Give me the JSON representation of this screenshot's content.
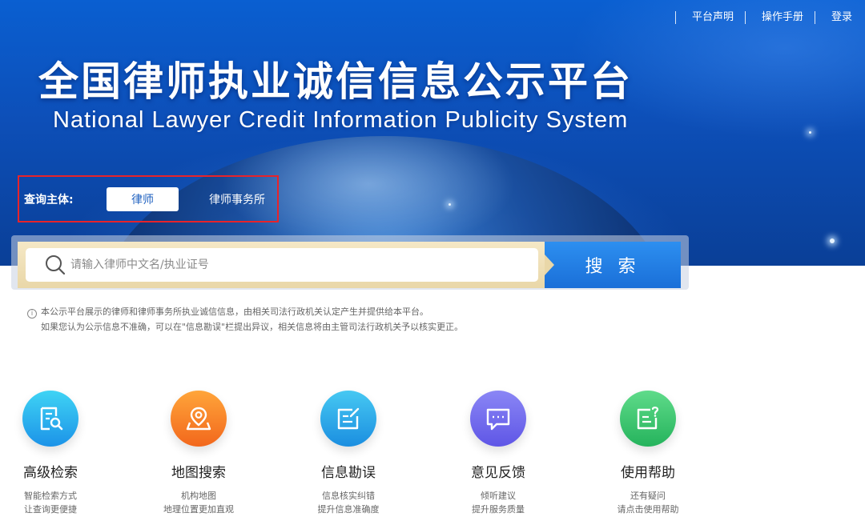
{
  "header": {
    "links": [
      "平台声明",
      "操作手册",
      "登录"
    ],
    "title_cn": "全国律师执业诚信信息公示平台",
    "title_en": "National Lawyer Credit Information Publicity System"
  },
  "query_subject": {
    "label": "查询主体:",
    "options": [
      "律师",
      "律师事务所"
    ],
    "selected": "律师"
  },
  "search": {
    "placeholder": "请输入律师中文名/执业证号",
    "button_label": "搜 索"
  },
  "notice": {
    "line1": "本公示平台展示的律师和律师事务所执业诚信信息，由相关司法行政机关认定产生并提供给本平台。",
    "line2": "如果您认为公示信息不准确，可以在\"信息勘误\"栏提出异议，相关信息将由主管司法行政机关予以核实更正。"
  },
  "features": [
    {
      "title": "高级检索",
      "desc1": "智能检索方式",
      "desc2": "让查询更便捷",
      "icon": "advanced-search-icon",
      "color_from": "#3fd3f4",
      "color_to": "#1c93e8"
    },
    {
      "title": "地图搜索",
      "desc1": "机构地图",
      "desc2": "地理位置更加直观",
      "icon": "map-pin-icon",
      "color_from": "#ffa53a",
      "color_to": "#f2671c"
    },
    {
      "title": "信息勘误",
      "desc1": "信息核实纠错",
      "desc2": "提升信息准确度",
      "icon": "edit-note-icon",
      "color_from": "#46c8f2",
      "color_to": "#1b8ee0"
    },
    {
      "title": "意见反馈",
      "desc1": "倾听建议",
      "desc2": "提升服务质量",
      "icon": "chat-bubble-icon",
      "color_from": "#8a86f5",
      "color_to": "#5f56e6"
    },
    {
      "title": "使用帮助",
      "desc1": "还有疑问",
      "desc2": "请点击使用帮助",
      "icon": "help-doc-icon",
      "color_from": "#5fdb8a",
      "color_to": "#25b35c"
    }
  ]
}
